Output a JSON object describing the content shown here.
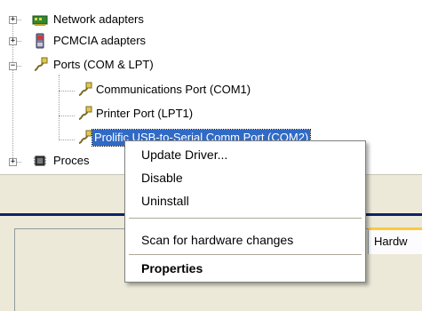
{
  "tree": {
    "items": [
      {
        "label": "Network adapters",
        "icon": "network-adapter-icon",
        "expander": "+"
      },
      {
        "label": "PCMCIA adapters",
        "icon": "pcmcia-icon",
        "expander": "+"
      },
      {
        "label": "Ports (COM & LPT)",
        "icon": "port-icon",
        "expander": "−"
      },
      {
        "label": "Communications Port (COM1)",
        "icon": "port-icon"
      },
      {
        "label": "Printer Port (LPT1)",
        "icon": "port-icon"
      },
      {
        "label": "Prolific USB-to-Serial Comm Port (COM2)",
        "icon": "port-icon",
        "selected": true
      },
      {
        "label": "Proces",
        "icon": "processor-icon",
        "expander": "+"
      }
    ]
  },
  "dialog": {
    "tab_label": "Hardw"
  },
  "context_menu": {
    "items": [
      {
        "label": "Update Driver..."
      },
      {
        "label": "Disable"
      },
      {
        "label": "Uninstall"
      },
      {
        "label": "Scan for hardware changes"
      },
      {
        "label": "Properties",
        "bold": true
      }
    ]
  },
  "colors": {
    "selection": "#316ac5",
    "dialog_face": "#ece9d8",
    "dialog_title_blue": "#0a246a",
    "tab_highlight": "#ffc83c"
  }
}
